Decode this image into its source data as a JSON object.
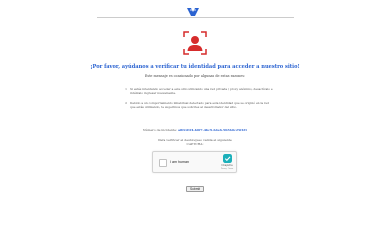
{
  "header": {
    "logo_icon": "ukrainian-trident-logo-icon",
    "logo_color": "#2b63d1"
  },
  "identity_icon": "user-identity-scan-icon",
  "identity_icon_color": "#d62c2c",
  "main": {
    "headline": "¡Por favor, ayúdanos a verificar tu identidad para acceder a nuestro sitio!",
    "subheadline": "Este mensaje es ocasionado por algunas de estas razones:",
    "reasons": [
      {
        "number": "1",
        "text": "Si estás intentando acceder a este sitio utilizando una red privada / proxy anónimo, desactívalo e inténtalo ingresar nuevamente."
      },
      {
        "number": "2",
        "text": "Debido a un comportamiento inhabitual detectado para esta identidad que se originó en la red que estás utilizando, te sugerimos que solicites al desarrollador del sitio."
      }
    ],
    "incident_label": "Número de incidente:",
    "incident_id": "a8f2d1f4-b0f7-4bc9-b4e6-9b5b0c25f4f1",
    "verify_instruction": "Para verificar el desbloqueo valida el siguiente CAPTCHA:"
  },
  "captcha": {
    "checkbox_label": "I am human",
    "brand": "hCaptcha",
    "links": "Privacy · Terms",
    "brand_color": "#1cb0ba"
  },
  "submit_label": "Submit",
  "accent_color": "#2b63d1"
}
